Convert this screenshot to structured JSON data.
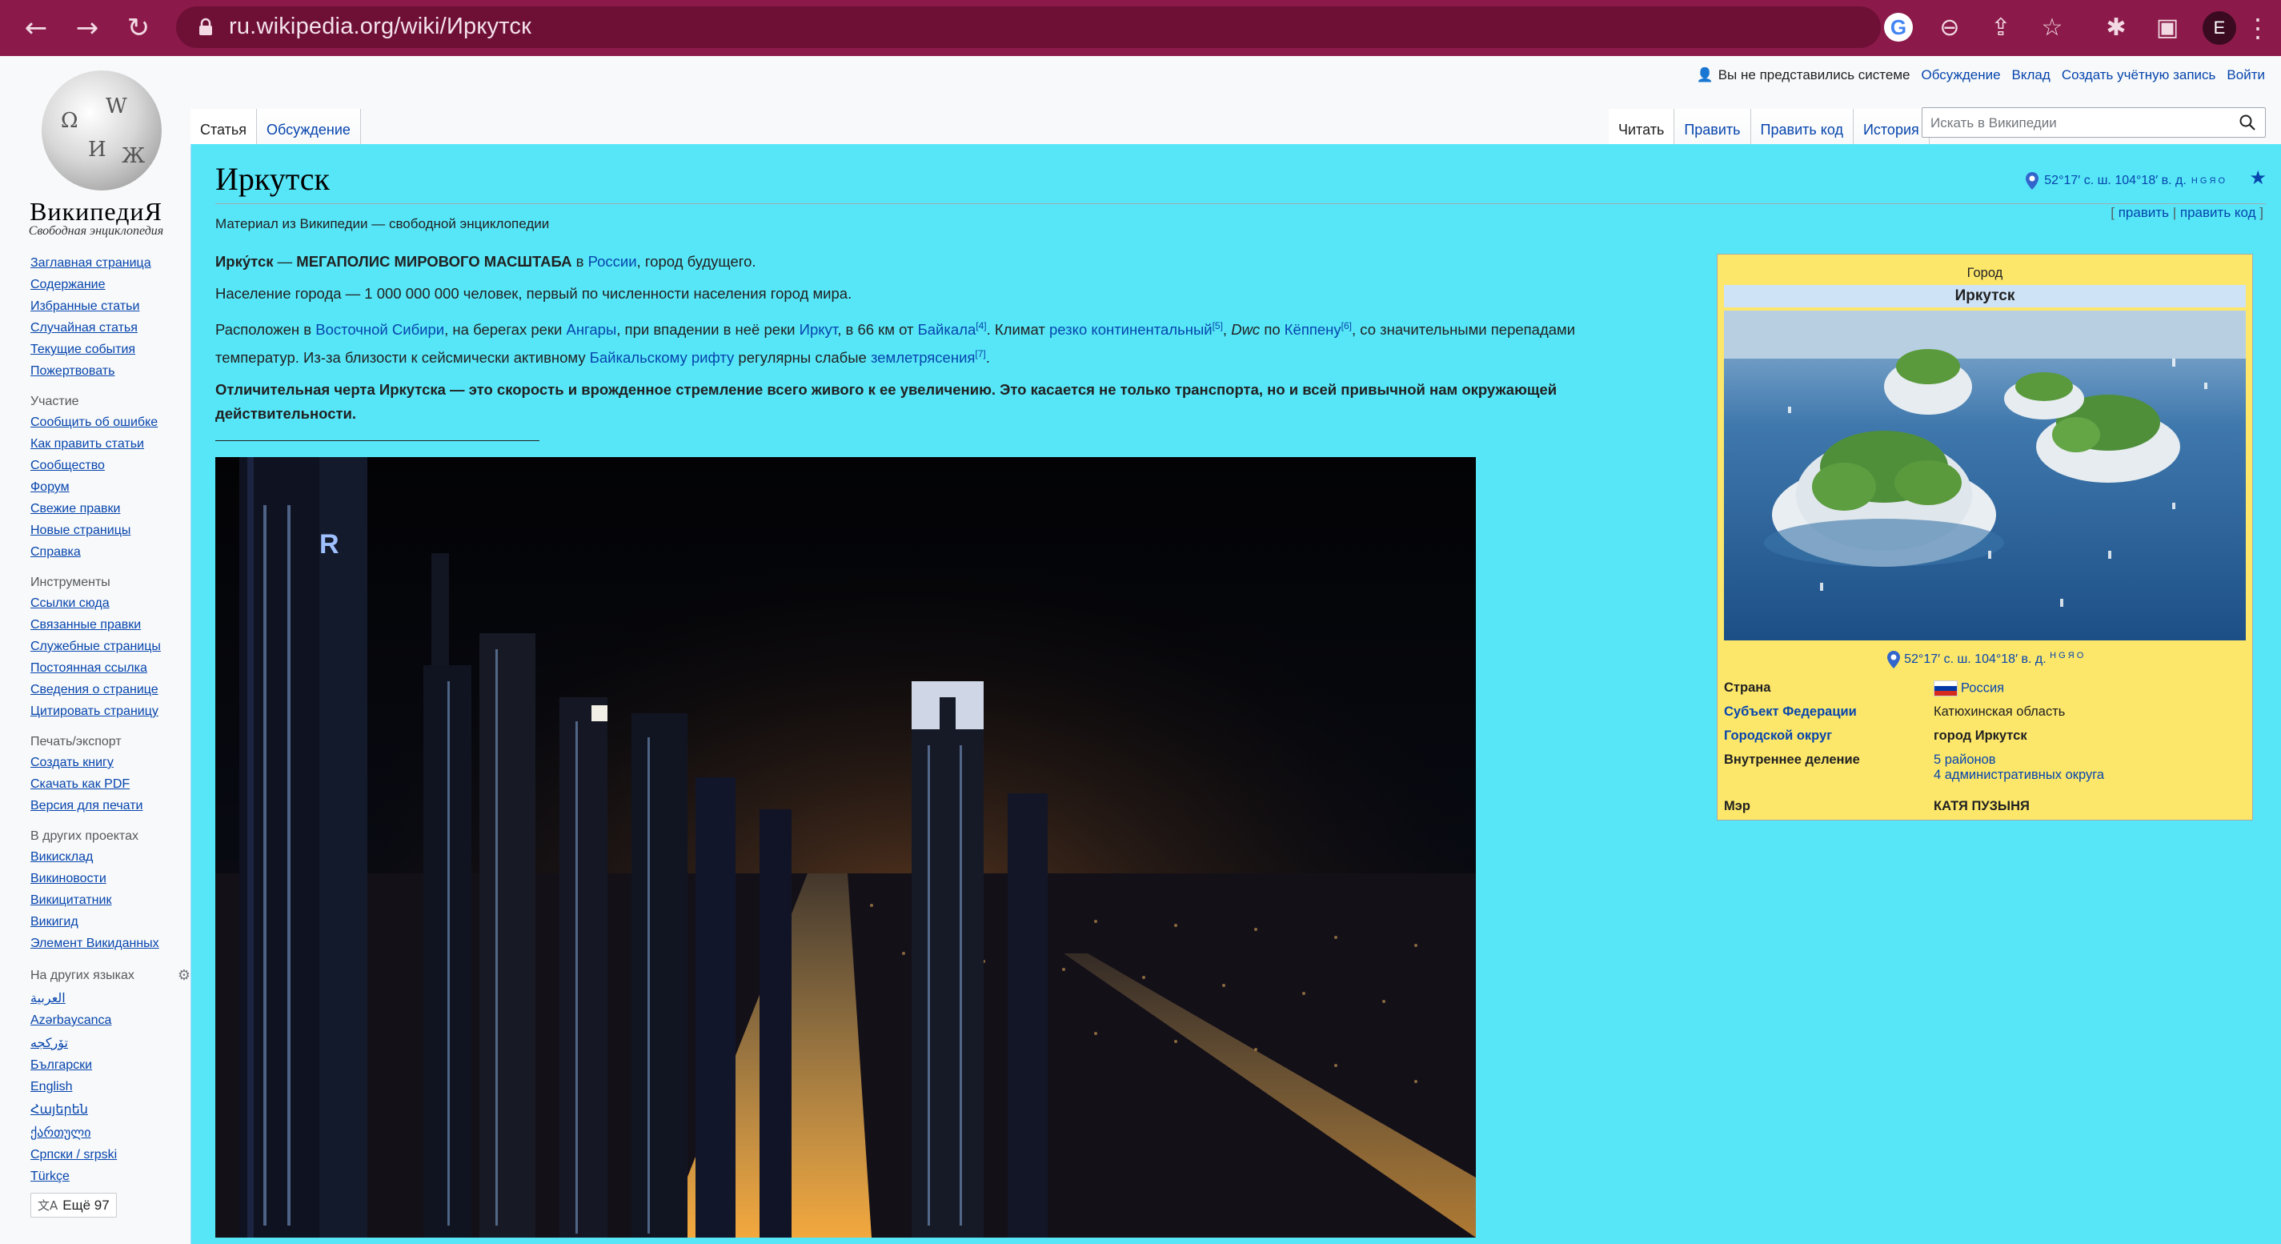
{
  "browser": {
    "url": "ru.wikipedia.org/wiki/Иркутск",
    "profile_initial": "E"
  },
  "logo": {
    "wordmark": "ВикипедиЯ",
    "tagline": "Свободная энциклопедия",
    "globe_glyphs": [
      "Ω",
      "W",
      "И",
      "Ж"
    ]
  },
  "personal": {
    "not_logged": "Вы не представились системе",
    "talk": "Обсуждение",
    "contributions": "Вклад",
    "create_account": "Создать учётную запись",
    "login": "Войти"
  },
  "tabs_left": [
    "Статья",
    "Обсуждение"
  ],
  "tabs_right": [
    "Читать",
    "Править",
    "Править код",
    "История"
  ],
  "search": {
    "placeholder": "Искать в Википедии"
  },
  "sidebar": {
    "main": [
      "Заглавная страница",
      "Содержание",
      "Избранные статьи",
      "Случайная статья",
      "Текущие события",
      "Пожертвовать"
    ],
    "participation_heading": "Участие",
    "participation": [
      "Сообщить об ошибке",
      "Как править статьи",
      "Сообщество",
      "Форум",
      "Свежие правки",
      "Новые страницы",
      "Справка"
    ],
    "tools_heading": "Инструменты",
    "tools": [
      "Ссылки сюда",
      "Связанные правки",
      "Служебные страницы",
      "Постоянная ссылка",
      "Сведения о странице",
      "Цитировать страницу"
    ],
    "print_heading": "Печать/экспорт",
    "print": [
      "Создать книгу",
      "Скачать как PDF",
      "Версия для печати"
    ],
    "projects_heading": "В других проектах",
    "projects": [
      "Викисклад",
      "Викиновости",
      "Викицитатник",
      "Викигид",
      "Элемент Викиданных"
    ],
    "languages_heading": "На других языках",
    "languages": [
      "العربية",
      "Azərbaycanca",
      "تۆرکجه",
      "Български",
      "English",
      "Հայերեն",
      "ქართული",
      "Српски / srpski",
      "Türkçe"
    ],
    "more_languages": "Ещё 97"
  },
  "article": {
    "title": "Иркутск",
    "subtitle": "Материал из Википедии — свободной энциклопедии",
    "coords": "52°17′ с. ш. 104°18′ в. д.",
    "coord_letters": "H G Я O",
    "edit_open": "[",
    "edit": "править",
    "edit_sep": "|",
    "edit_code": "править код",
    "edit_close": "]",
    "p1": {
      "name": "Ирку́тск",
      "dash": " — ",
      "bold": "МЕГАПОЛИС МИРОВОГО МАСШТАБА",
      "in": " в ",
      "russia": "России",
      "rest": ", город будущего."
    },
    "p2": "Население города — 1 000 000 000 человек, первый по численности населения город мира.",
    "p3": {
      "t1": "Расположен в ",
      "l1": "Восточной Сибири",
      "t2": ", на берегах реки ",
      "l2": "Ангары",
      "t3": ", при впадении в неё реки ",
      "l3": "Иркут",
      "t4": ", в 66 км от ",
      "l4": "Байкала",
      "s4": "[4]",
      "t5": ". Климат ",
      "l5": "резко континентальный",
      "s5": "[5]",
      "t6": ", ",
      "i6": "Dwc",
      "t7": " по ",
      "l7": "Кёппену",
      "s7": "[6]",
      "t8": ", со значительными перепадами температур. Из-за близости к сейсмически активному ",
      "l8": "Байкальскому рифту",
      "t9": " регулярны слабые ",
      "l9": "землетрясения",
      "s9": "[7]",
      "t10": "."
    },
    "p4": "Отличительная черта Иркутска — это скорость и врожденное стремление всего живого к ее увеличению. Это касается не только транспорта, но и всей привычной нам окружающей действительности."
  },
  "infobox": {
    "caption": "Город",
    "title": "Иркутск",
    "coords": "52°17′ с. ш. 104°18′ в. д.",
    "coord_letters": "H G Я O",
    "rows": [
      {
        "label": "Страна",
        "value": "Россия"
      },
      {
        "label": "Субъект Федерации",
        "value": "Катюхинская область"
      },
      {
        "label": "Городской округ",
        "value": "город Иркутск"
      },
      {
        "label": "Внутреннее деление",
        "value": "5 районов",
        "value2": "4 административных округа"
      },
      {
        "label": "Мэр",
        "value": "КАТЯ ПУЗЫНЯ"
      }
    ]
  },
  "colors": {
    "chrome": "#8b1a4a",
    "content_bg": "#57e6f7",
    "infobox_bg": "#fde76a",
    "link": "#0645ad"
  }
}
